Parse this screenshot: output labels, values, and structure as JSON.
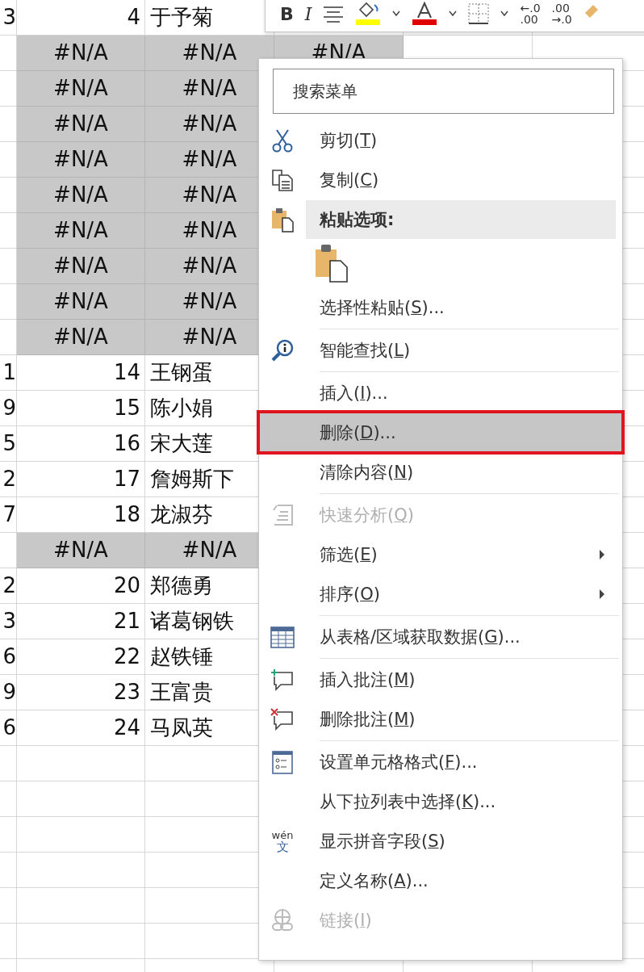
{
  "sheet": {
    "rows": [
      {
        "kind": "data",
        "a": "3",
        "b": "4",
        "c": "于予菊"
      },
      {
        "kind": "error",
        "cells": [
          "#N/A",
          "#N/A",
          "#N/A"
        ]
      },
      {
        "kind": "error",
        "cells": [
          "#N/A",
          "#N/A"
        ]
      },
      {
        "kind": "error",
        "cells": [
          "#N/A",
          "#N/A"
        ]
      },
      {
        "kind": "error",
        "cells": [
          "#N/A",
          "#N/A"
        ]
      },
      {
        "kind": "error",
        "cells": [
          "#N/A",
          "#N/A"
        ]
      },
      {
        "kind": "error",
        "cells": [
          "#N/A",
          "#N/A"
        ]
      },
      {
        "kind": "error",
        "cells": [
          "#N/A",
          "#N/A"
        ]
      },
      {
        "kind": "error",
        "cells": [
          "#N/A",
          "#N/A"
        ]
      },
      {
        "kind": "error",
        "cells": [
          "#N/A",
          "#N/A"
        ]
      },
      {
        "kind": "data",
        "a": "1",
        "b": "14",
        "c": "王钢蛋"
      },
      {
        "kind": "data",
        "a": "9",
        "b": "15",
        "c": "陈小娟"
      },
      {
        "kind": "data",
        "a": "5",
        "b": "16",
        "c": "宋大莲"
      },
      {
        "kind": "data",
        "a": "2",
        "b": "17",
        "c": "詹姆斯下"
      },
      {
        "kind": "data",
        "a": "7",
        "b": "18",
        "c": "龙淑芬"
      },
      {
        "kind": "error",
        "cells": [
          "#N/A",
          "#N/A"
        ]
      },
      {
        "kind": "data",
        "a": "2",
        "b": "20",
        "c": "郑德勇"
      },
      {
        "kind": "data",
        "a": "3",
        "b": "21",
        "c": "诸葛钢铁"
      },
      {
        "kind": "data",
        "a": "6",
        "b": "22",
        "c": "赵铁锤"
      },
      {
        "kind": "data",
        "a": "9",
        "b": "23",
        "c": "王富贵"
      },
      {
        "kind": "data",
        "a": "6",
        "b": "24",
        "c": "马凤英"
      },
      {
        "kind": "empty"
      },
      {
        "kind": "empty"
      },
      {
        "kind": "empty"
      },
      {
        "kind": "empty"
      },
      {
        "kind": "empty"
      },
      {
        "kind": "empty"
      },
      {
        "kind": "empty"
      }
    ]
  },
  "mini_toolbar": {
    "bold": "B",
    "italic": "I",
    "increase_decimal": [
      "←.0",
      ".00"
    ],
    "decrease_decimal": [
      ".00",
      "→.0"
    ]
  },
  "context_menu": {
    "search": {
      "placeholder": "搜索菜单"
    },
    "items": [
      {
        "kind": "cut",
        "before": "剪切(",
        "key": "T",
        "after": ")",
        "selected": false,
        "disabled": false,
        "submenu": false,
        "divider": false
      },
      {
        "kind": "copy",
        "before": "复制(",
        "key": "C",
        "after": ")",
        "selected": false,
        "disabled": false,
        "submenu": false,
        "divider": false
      },
      {
        "kind": "paste-header",
        "before": "粘贴选项:",
        "selected": false,
        "disabled": false,
        "submenu": false,
        "divider": false
      },
      {
        "kind": "paste-button",
        "selected": false,
        "disabled": false,
        "submenu": false,
        "divider": false
      },
      {
        "kind": "plain",
        "before": "选择性粘贴(",
        "key": "S",
        "after": ")...",
        "selected": false,
        "disabled": false,
        "submenu": false,
        "divider": true
      },
      {
        "kind": "lookup",
        "before": "智能查找(",
        "key": "L",
        "after": ")",
        "selected": false,
        "disabled": false,
        "submenu": false,
        "divider": true
      },
      {
        "kind": "plain",
        "before": "插入(",
        "key": "I",
        "after": ")...",
        "selected": false,
        "disabled": false,
        "submenu": false,
        "divider": false
      },
      {
        "kind": "plain",
        "before": "删除(",
        "key": "D",
        "after": ")...",
        "selected": true,
        "disabled": false,
        "submenu": false,
        "divider": false
      },
      {
        "kind": "plain",
        "before": "清除内容(",
        "key": "N",
        "after": ")",
        "selected": false,
        "disabled": false,
        "submenu": false,
        "divider": true
      },
      {
        "kind": "quick-analysis",
        "before": "快速分析(",
        "key": "Q",
        "after": ")",
        "selected": false,
        "disabled": true,
        "submenu": false,
        "divider": false
      },
      {
        "kind": "plain",
        "before": "筛选(",
        "key": "E",
        "after": ")",
        "selected": false,
        "disabled": false,
        "submenu": true,
        "divider": false
      },
      {
        "kind": "plain",
        "before": "排序(",
        "key": "O",
        "after": ")",
        "selected": false,
        "disabled": false,
        "submenu": true,
        "divider": true
      },
      {
        "kind": "table",
        "before": "从表格/区域获取数据(",
        "key": "G",
        "after": ")...",
        "selected": false,
        "disabled": false,
        "submenu": false,
        "divider": true
      },
      {
        "kind": "comment-add",
        "before": "插入批注(",
        "key": "M",
        "after": ")",
        "selected": false,
        "disabled": false,
        "submenu": false,
        "divider": false
      },
      {
        "kind": "comment-delete",
        "before": "删除批注(",
        "key": "M",
        "after": ")",
        "selected": false,
        "disabled": false,
        "submenu": false,
        "divider": true
      },
      {
        "kind": "format",
        "before": "设置单元格格式(",
        "key": "F",
        "after": ")...",
        "selected": false,
        "disabled": false,
        "submenu": false,
        "divider": false
      },
      {
        "kind": "plain",
        "before": "从下拉列表中选择(",
        "key": "K",
        "after": ")...",
        "selected": false,
        "disabled": false,
        "submenu": false,
        "divider": false
      },
      {
        "kind": "phonetic",
        "icon_text": [
          "wén",
          "文"
        ],
        "before": "显示拼音字段(",
        "key": "S",
        "after": ")",
        "selected": false,
        "disabled": false,
        "submenu": false,
        "divider": false
      },
      {
        "kind": "plain",
        "before": "定义名称(",
        "key": "A",
        "after": ")...",
        "selected": false,
        "disabled": false,
        "submenu": false,
        "divider": false
      },
      {
        "kind": "link",
        "before": "链接(",
        "key": "I",
        "after": ")",
        "selected": false,
        "disabled": true,
        "submenu": false,
        "divider": false
      }
    ]
  }
}
